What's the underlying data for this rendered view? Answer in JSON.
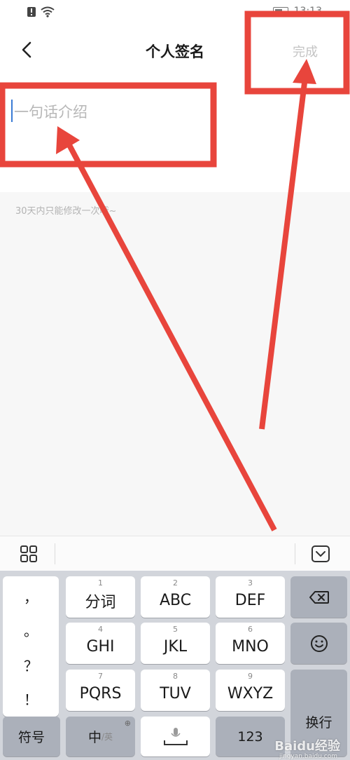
{
  "status_bar": {
    "left_icons": [
      "alert-icon",
      "wifi-icon"
    ],
    "time": "13:13"
  },
  "header": {
    "back_icon": "chevron-left-icon",
    "title": "个人签名",
    "done_label": "完成"
  },
  "input": {
    "placeholder": "一句话介绍"
  },
  "hint": "30天内只能修改一次哦~",
  "keyboard_toolbar": {
    "left_icon": "grid-icon",
    "right_icon": "collapse-keyboard-icon"
  },
  "keyboard": {
    "punctuation": [
      "，",
      "。",
      "？",
      "！"
    ],
    "keys": [
      {
        "num": "1",
        "label": "分词"
      },
      {
        "num": "2",
        "label": "ABC"
      },
      {
        "num": "3",
        "label": "DEF"
      },
      {
        "num": "4",
        "label": "GHI"
      },
      {
        "num": "5",
        "label": "JKL"
      },
      {
        "num": "6",
        "label": "MNO"
      },
      {
        "num": "7",
        "label": "PQRS"
      },
      {
        "num": "8",
        "label": "TUV"
      },
      {
        "num": "9",
        "label": "WXYZ"
      }
    ],
    "symbols_label": "符号",
    "lang_main": "中",
    "lang_sub": "/英",
    "numbers_label": "123",
    "enter_label": "换行"
  },
  "watermark": {
    "main": "Baidu经验",
    "sub": "jingyan.baidu.com"
  },
  "colors": {
    "annotation": "#e8453c",
    "caret": "#3a7bd5",
    "done_disabled": "#c4c4c4"
  }
}
